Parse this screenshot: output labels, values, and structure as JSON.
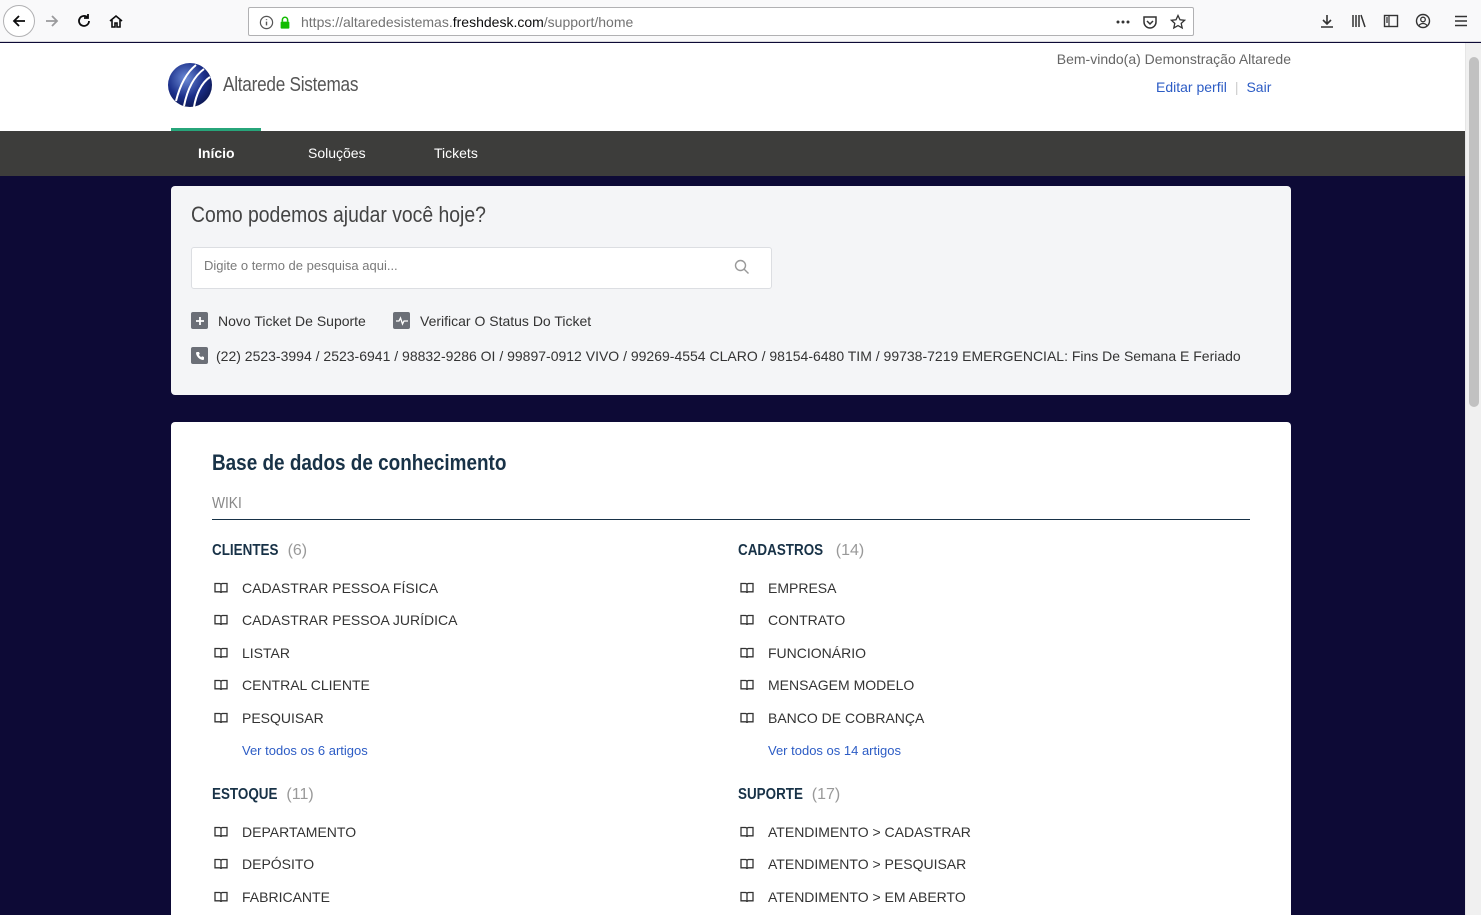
{
  "browser": {
    "url_prefix": "https://altaredesistemas.",
    "url_domain": "freshdesk.com",
    "url_path": "/support/home"
  },
  "header": {
    "brand": "Altarede Sistemas",
    "welcome": "Bem-vindo(a) Demonstração Altarede",
    "edit_profile": "Editar perfil",
    "logout": "Sair"
  },
  "nav": {
    "items": [
      {
        "label": "Início"
      },
      {
        "label": "Soluções"
      },
      {
        "label": "Tickets"
      }
    ]
  },
  "help": {
    "title": "Como podemos ajudar você hoje?",
    "search_placeholder": "Digite o termo de pesquisa aqui...",
    "new_ticket": "Novo Ticket De Suporte",
    "check_status": "Verificar O Status Do Ticket",
    "phones": "(22) 2523-3994 / 2523-6941 / 98832-9286 OI / 99897-0912 VIVO / 99269-4554 CLARO / 98154-6480 TIM / 99738-7219 EMERGENCIAL: Fins De Semana E Feriado"
  },
  "kb": {
    "title": "Base de dados de conhecimento",
    "section": "WIKI",
    "categories": [
      {
        "name": "CLIENTES",
        "count": "(6)",
        "articles": [
          "CADASTRAR PESSOA FÍSICA",
          "CADASTRAR PESSOA JURÍDICA",
          "LISTAR",
          "CENTRAL CLIENTE",
          "PESQUISAR"
        ],
        "more": "Ver todos os 6 artigos"
      },
      {
        "name": "CADASTROS",
        "count": "(14)",
        "articles": [
          "EMPRESA",
          "CONTRATO",
          "FUNCIONÁRIO",
          "MENSAGEM MODELO",
          "BANCO DE COBRANÇA"
        ],
        "more": "Ver todos os 14 artigos"
      },
      {
        "name": "ESTOQUE",
        "count": "(11)",
        "articles": [
          "DEPARTAMENTO",
          "DEPÓSITO",
          "FABRICANTE"
        ]
      },
      {
        "name": "SUPORTE",
        "count": "(17)",
        "articles": [
          "ATENDIMENTO > CADASTRAR",
          "ATENDIMENTO > PESQUISAR",
          "ATENDIMENTO > EM ABERTO"
        ]
      }
    ]
  }
}
